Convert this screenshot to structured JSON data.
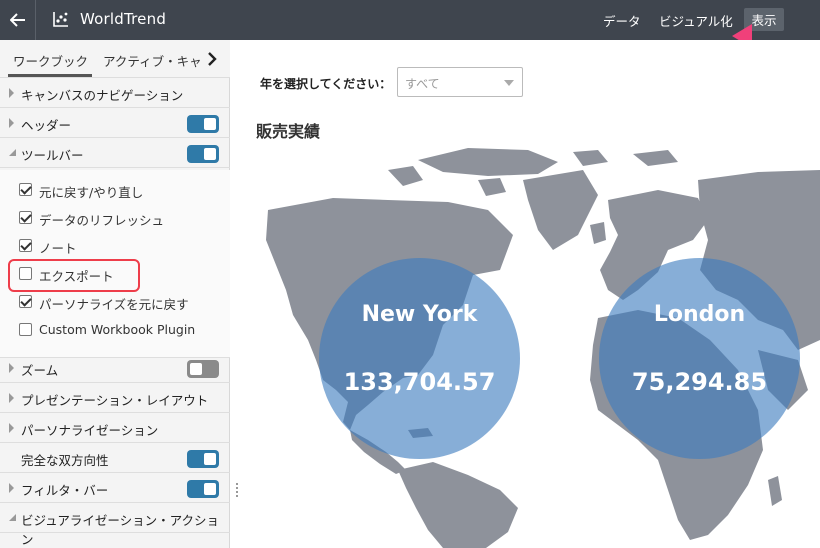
{
  "header": {
    "app_title": "WorldTrend",
    "nav": {
      "data": "データ",
      "visualize": "ビジュアル化",
      "present": "表示"
    }
  },
  "panel": {
    "tabs": {
      "workbook": "ワークブック",
      "active": "アクティブ・キャ"
    },
    "rows": {
      "canvas_nav": "キャンバスのナビゲーション",
      "header": "ヘッダー",
      "toolbar": "ツールバー",
      "zoom": "ズーム",
      "presentation_layout": "プレゼンテーション・レイアウト",
      "personalization": "パーソナライゼーション",
      "bidirectional": "完全な双方向性",
      "filter_bar": "フィルタ・バー",
      "viz_action": "ビジュアライゼーション・アクション"
    },
    "toggles": {
      "header": true,
      "toolbar": true,
      "zoom": false,
      "bidirectional": true,
      "filter_bar": true
    },
    "toolbar_items": [
      {
        "label": "元に戻す/やり直し",
        "checked": true
      },
      {
        "label": "データのリフレッシュ",
        "checked": true
      },
      {
        "label": "ノート",
        "checked": true
      },
      {
        "label": "エクスポート",
        "checked": false
      },
      {
        "label": "パーソナライズを元に戻す",
        "checked": true
      },
      {
        "label": "Custom Workbook Plugin",
        "checked": false
      }
    ]
  },
  "canvas": {
    "filter_label": "年を選択してください：",
    "filter_value": "すべて",
    "viz_title": "販売実績",
    "bubbles": [
      {
        "city": "New York",
        "value": "133,704.57"
      },
      {
        "city": "London",
        "value": "75,294.85"
      }
    ],
    "colors": {
      "bubble": "#3e7cbe",
      "land": "#8e929b",
      "accent": "#2f7aa8",
      "highlight": "#ee3d4a"
    }
  }
}
